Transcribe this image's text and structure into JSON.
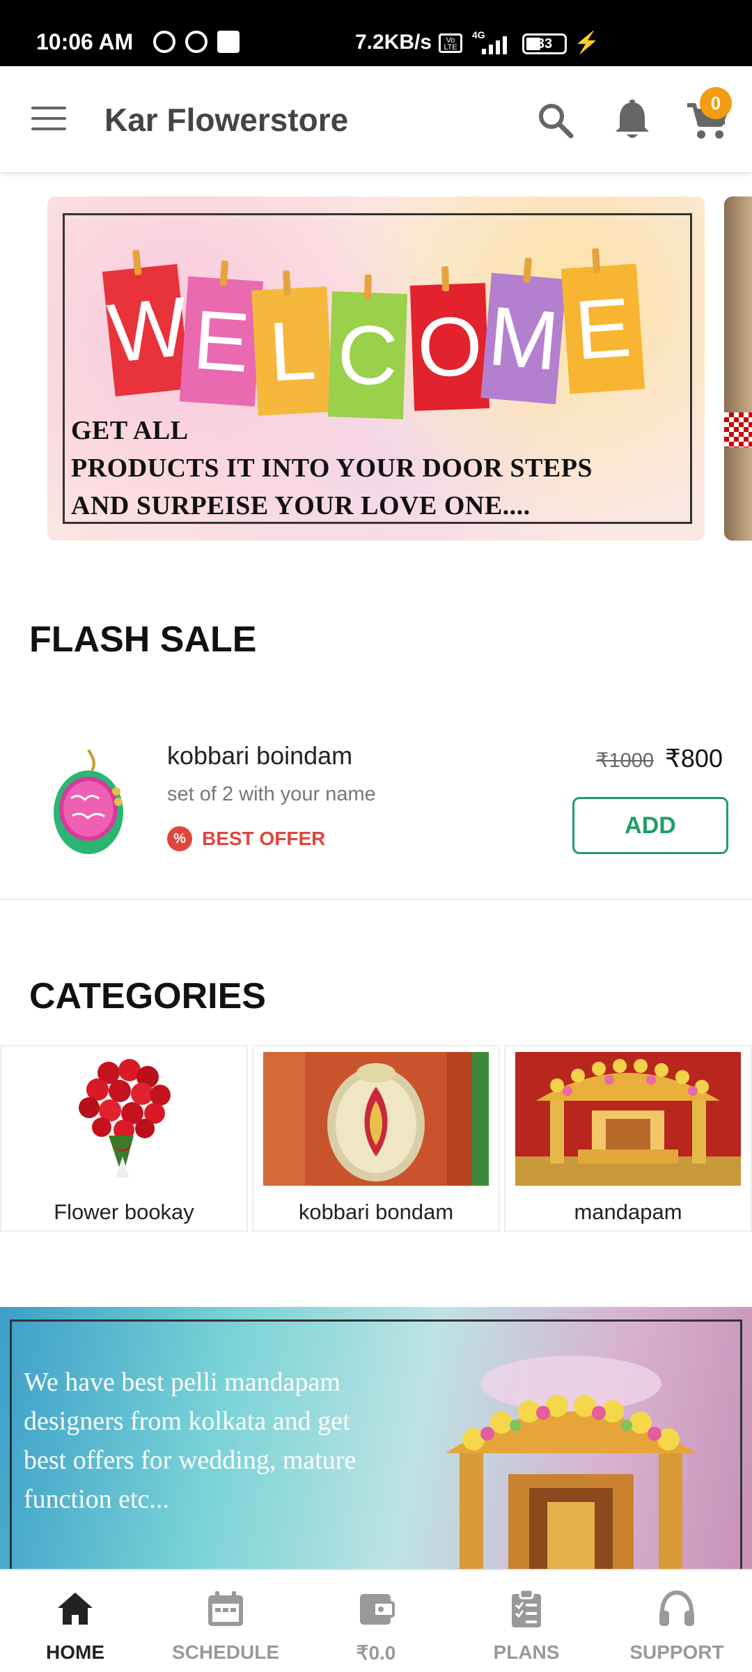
{
  "status_bar": {
    "time": "10:06 AM",
    "network_speed": "7.2KB/s",
    "volte": "Vo LTE",
    "network_type": "4G",
    "battery": "33"
  },
  "app_bar": {
    "title": "Kar Flowerstore",
    "cart_count": "0"
  },
  "banner": {
    "word_letters": [
      "W",
      "E",
      "L",
      "C",
      "O",
      "M",
      "E"
    ],
    "card_colors": [
      "#e8333a",
      "#e96ab0",
      "#f5b83c",
      "#9bd04a",
      "#e2222c",
      "#b57fd0",
      "#f7b531"
    ],
    "line1": "GET ALL",
    "line2": "PRODUCTS IT INTO YOUR DOOR STEPS",
    "line3": "AND SURPEISE YOUR LOVE ONE...."
  },
  "flash_sale": {
    "title": "FLASH SALE",
    "product": {
      "name": "kobbari boindam",
      "description": "set of 2 with your name",
      "offer_label": "BEST OFFER",
      "offer_icon_glyph": "%",
      "mrp": "₹1000",
      "price": "₹800",
      "add_label": "ADD"
    }
  },
  "categories": {
    "title": "CATEGORIES",
    "items": [
      {
        "label": "Flower bookay"
      },
      {
        "label": "kobbari bondam"
      },
      {
        "label": "mandapam"
      }
    ]
  },
  "promo": {
    "text": "We have best pelli mandapam designers from kolkata and get best offers for wedding, mature function etc..."
  },
  "bottom_nav": {
    "items": [
      {
        "label": "HOME",
        "icon": "home-icon"
      },
      {
        "label": "SCHEDULE",
        "icon": "calendar-icon"
      },
      {
        "label": "₹0.0",
        "icon": "wallet-icon"
      },
      {
        "label": "PLANS",
        "icon": "clipboard-icon"
      },
      {
        "label": "SUPPORT",
        "icon": "headset-icon"
      }
    ]
  },
  "colors": {
    "accent_green": "#1e9e6a",
    "offer_red": "#e0463c",
    "badge_orange": "#f39c12"
  }
}
